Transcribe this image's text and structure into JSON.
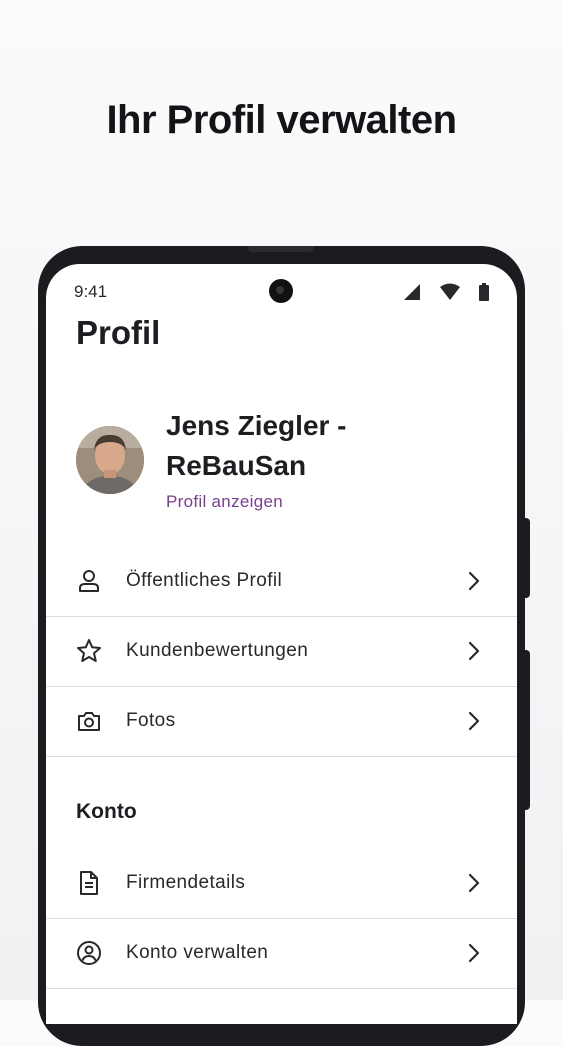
{
  "headline": "Ihr Profil verwalten",
  "status": {
    "time": "9:41"
  },
  "page": {
    "title": "Profil"
  },
  "profile": {
    "name": "Jens Ziegler - ReBauSan",
    "link": "Profil anzeigen"
  },
  "menu_profile": [
    {
      "label": "Öffentliches Profil",
      "icon": "person-icon"
    },
    {
      "label": "Kundenbewertungen",
      "icon": "star-icon"
    },
    {
      "label": "Fotos",
      "icon": "camera-icon"
    }
  ],
  "account_section": {
    "title": "Konto",
    "items": [
      {
        "label": "Firmendetails",
        "icon": "document-icon"
      },
      {
        "label": "Konto verwalten",
        "icon": "account-circle-icon"
      }
    ]
  },
  "colors": {
    "accent": "#7a3f8c",
    "text": "#1f1d22",
    "divider": "#dedcdf",
    "phone_frame": "#1c1b1f"
  }
}
